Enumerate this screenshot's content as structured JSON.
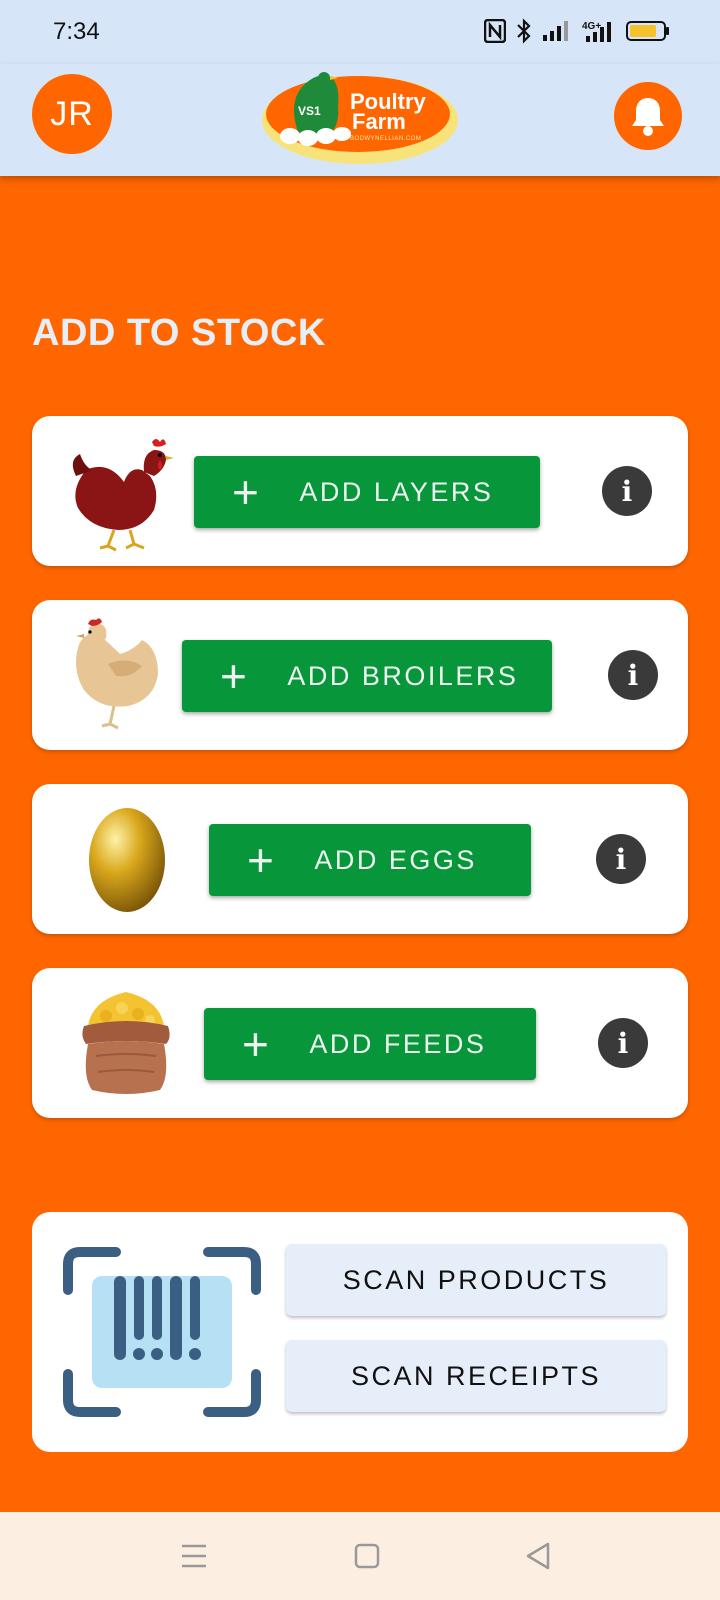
{
  "status_bar": {
    "time": "7:34",
    "icons": [
      "nfc-icon",
      "bluetooth-icon",
      "signal-icon",
      "4g-signal-icon",
      "battery-icon"
    ]
  },
  "header": {
    "avatar_initials": "JR",
    "logo": {
      "badge": "VS1",
      "title_line1": "Poultry",
      "title_line2": "Farm",
      "subtitle": "BODWYNELLIAN.COM"
    },
    "bell_icon": "bell-icon"
  },
  "page": {
    "title": "ADD TO STOCK"
  },
  "stock_items": [
    {
      "label": "ADD LAYERS",
      "icon": "layer-hen-icon"
    },
    {
      "label": "ADD BROILERS",
      "icon": "broiler-hen-icon"
    },
    {
      "label": "ADD EGGS",
      "icon": "golden-egg-icon"
    },
    {
      "label": "ADD FEEDS",
      "icon": "feed-sack-icon"
    }
  ],
  "scan": {
    "icon": "barcode-scan-icon",
    "products_label": "SCAN PRODUCTS",
    "receipts_label": "SCAN RECEIPTS"
  },
  "nav": [
    "menu-icon",
    "home-square-icon",
    "back-triangle-icon"
  ],
  "colors": {
    "primary": "#ff6600",
    "header_bg": "#d6e6f8",
    "button_green": "#07963a",
    "info": "#3a3a3a",
    "scan_button_bg": "#e6eef9"
  }
}
